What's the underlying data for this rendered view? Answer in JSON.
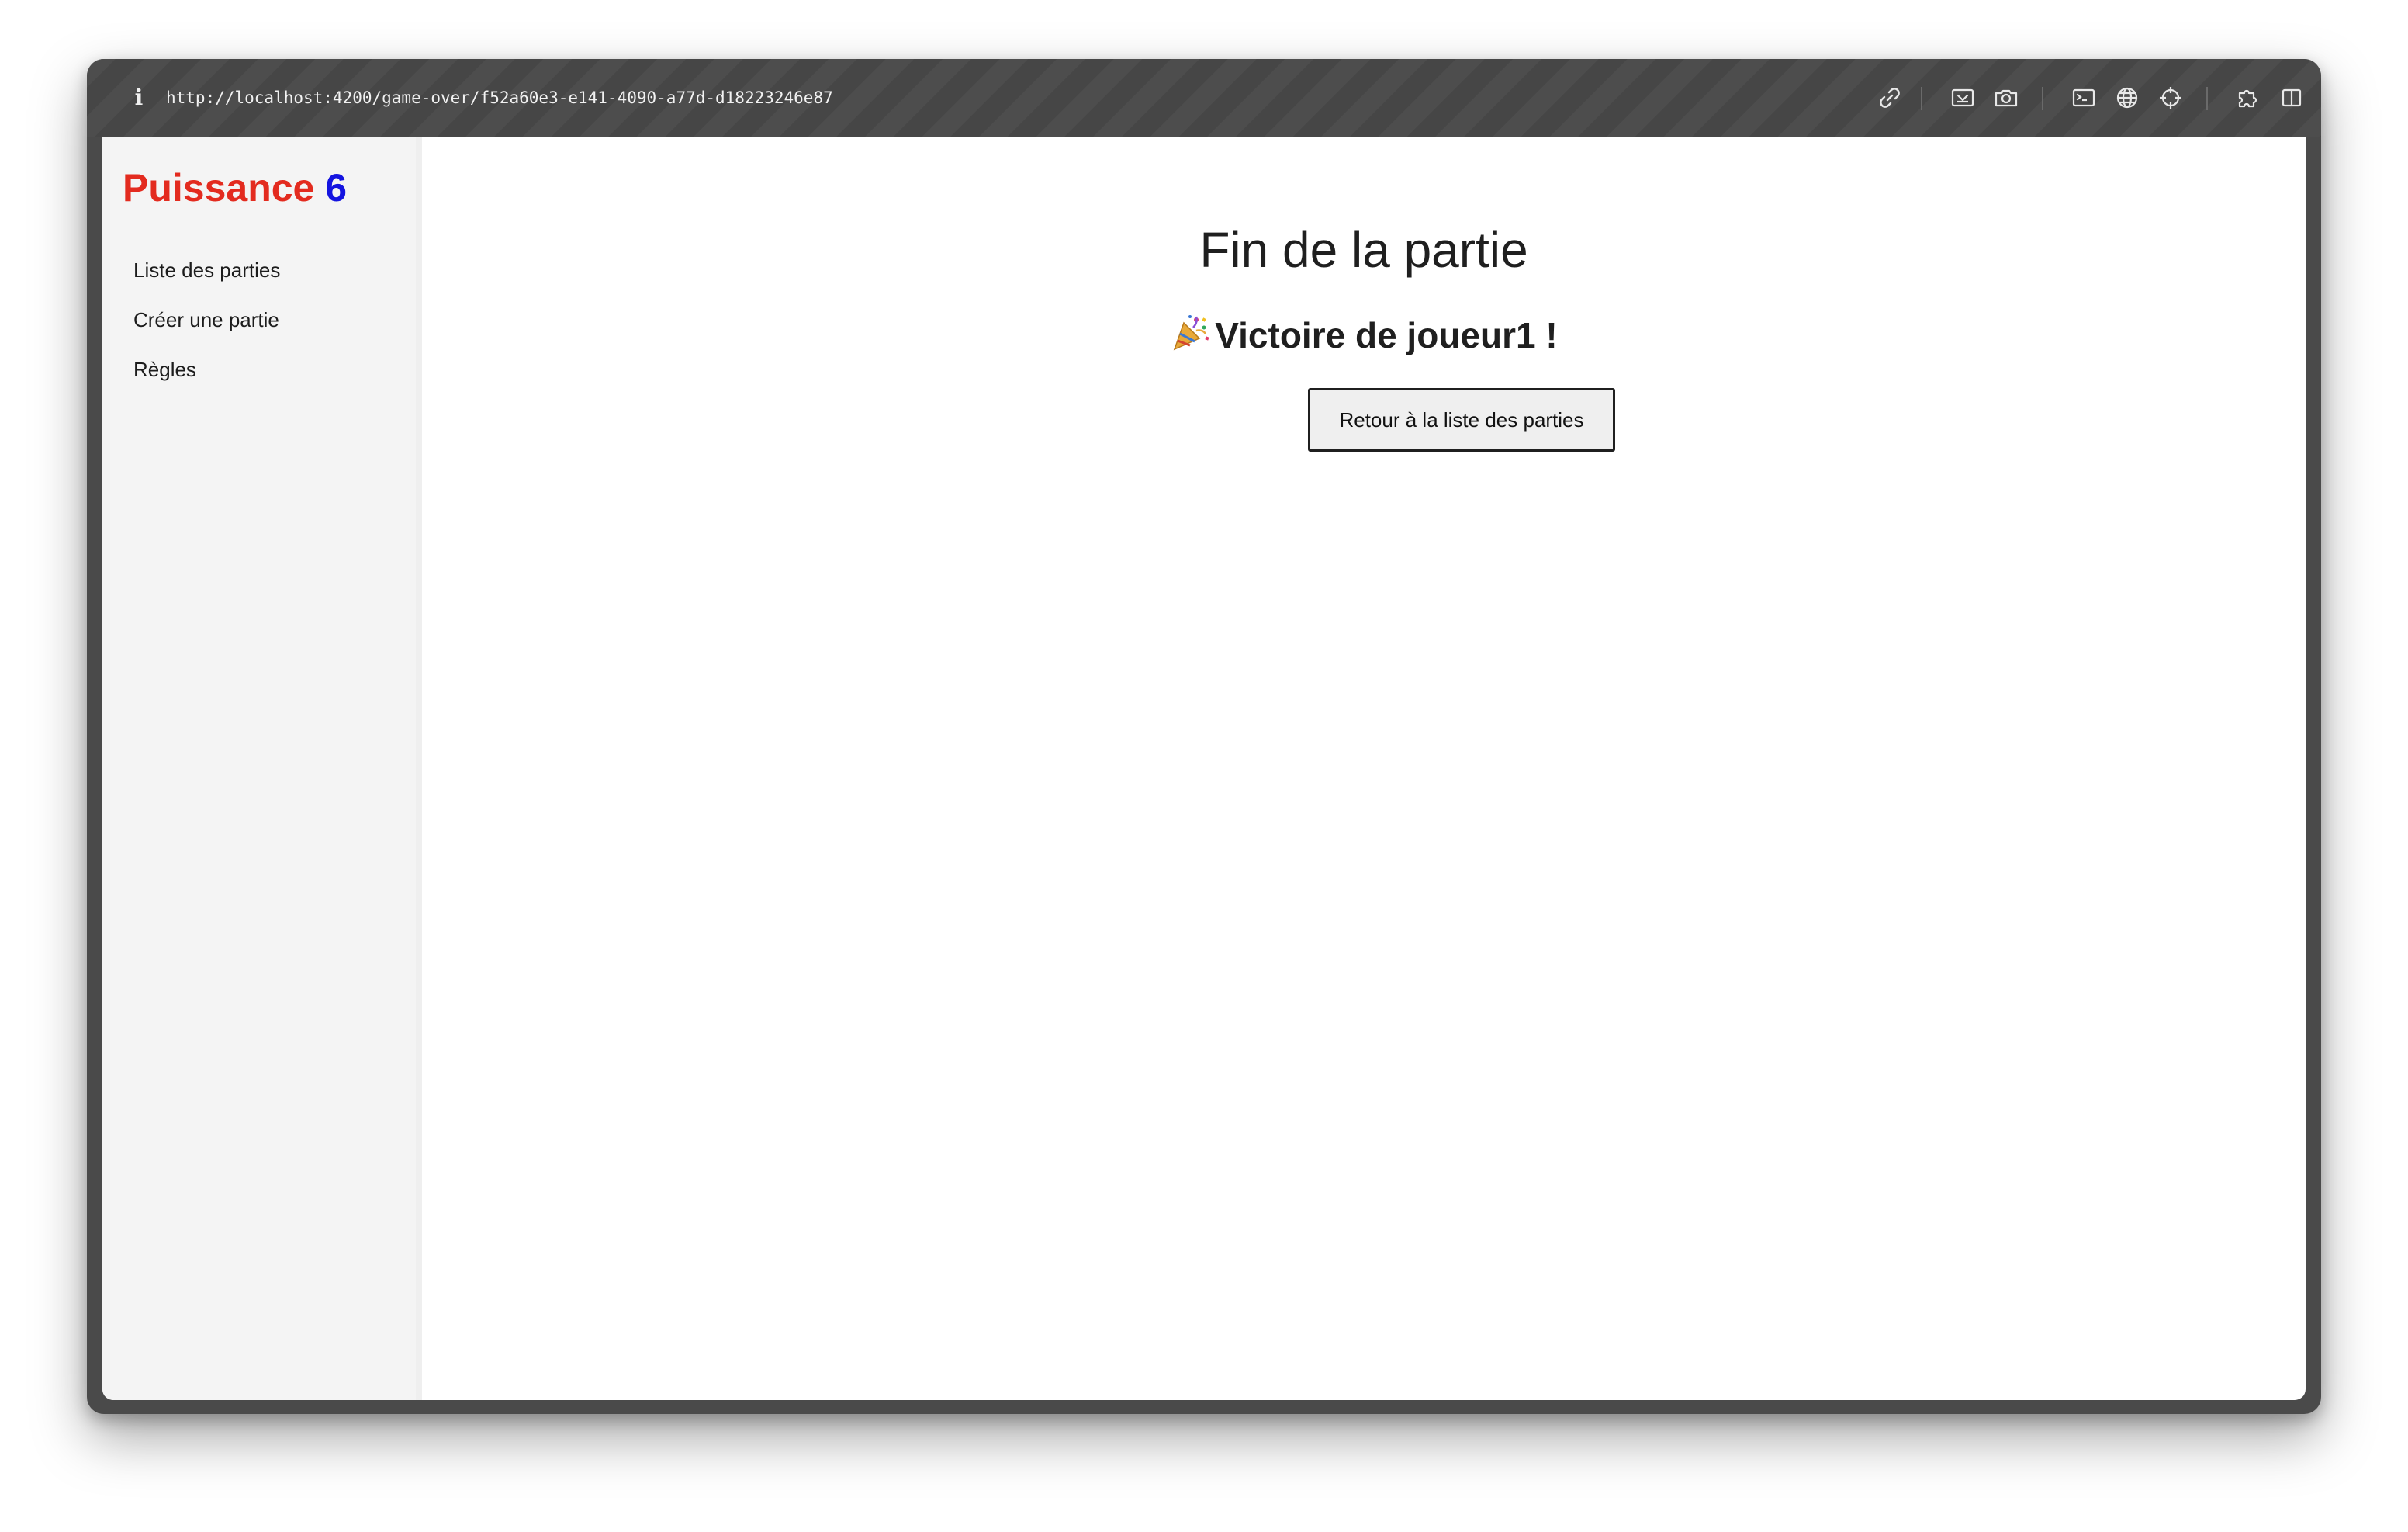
{
  "browser": {
    "url": "http://localhost:4200/game-over/f52a60e3-e141-4090-a77d-d18223246e87",
    "icons": [
      "info-icon",
      "link-icon",
      "screenshot-area-icon",
      "camera-icon",
      "terminal-icon",
      "globe-icon",
      "crosshair-icon",
      "extensions-icon",
      "sidebar-icon"
    ]
  },
  "sidebar": {
    "logo": {
      "word": "Puissance",
      "number": "6"
    },
    "items": [
      {
        "label": "Liste des parties"
      },
      {
        "label": "Créer une partie"
      },
      {
        "label": "Règles"
      }
    ]
  },
  "main": {
    "title": "Fin de la partie",
    "winner_text": "Victoire de joueur1 !",
    "winner_icon": "party-popper-icon",
    "back_button_label": "Retour à la liste des parties"
  },
  "colors": {
    "logo_word": "#e32b1f",
    "logo_number": "#1414e0",
    "sidebar_bg": "#f4f4f4",
    "toolbar_bg": "#4a4a4a"
  }
}
